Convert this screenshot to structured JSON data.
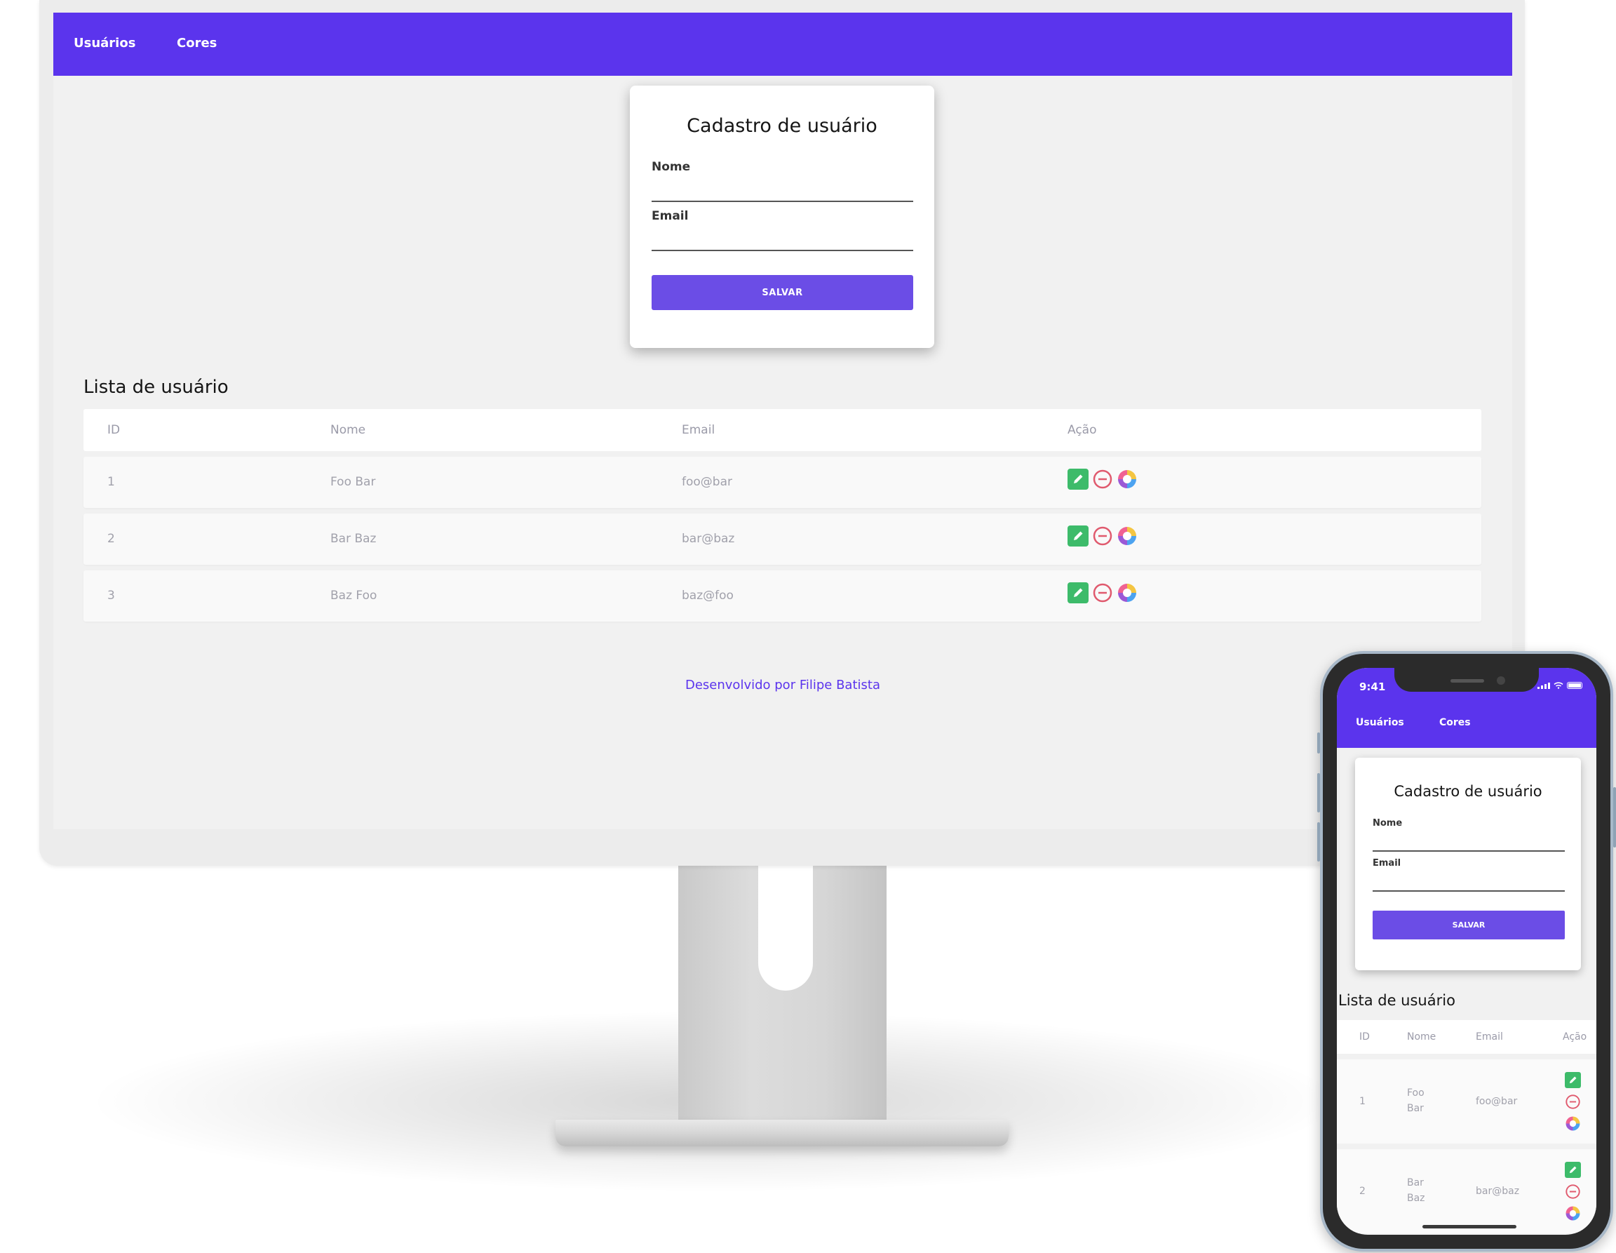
{
  "nav": {
    "users": "Usuários",
    "colors": "Cores"
  },
  "form": {
    "title": "Cadastro de usuário",
    "name_label": "Nome",
    "name_value": "",
    "email_label": "Email",
    "email_value": "",
    "save_label": "SALVAR"
  },
  "list": {
    "title": "Lista de usuário",
    "headers": {
      "id": "ID",
      "name": "Nome",
      "email": "Email",
      "action": "Ação"
    },
    "rows": [
      {
        "id": "1",
        "name": "Foo Bar",
        "email": "foo@bar"
      },
      {
        "id": "2",
        "name": "Bar Baz",
        "email": "bar@baz"
      },
      {
        "id": "3",
        "name": "Baz Foo",
        "email": "baz@foo"
      }
    ]
  },
  "footer": {
    "credit": "Desenvolvido por Filipe Batista"
  },
  "phone": {
    "time": "9:41",
    "rows": [
      {
        "id": "1",
        "name_line1": "Foo",
        "name_line2": "Bar",
        "email": "foo@bar"
      },
      {
        "id": "2",
        "name_line1": "Bar",
        "name_line2": "Baz",
        "email": "bar@baz"
      }
    ]
  },
  "colors": {
    "accent": "#5b34ed",
    "button": "#6b4de6",
    "edit": "#3dbb6a",
    "delete": "#e05a6e"
  },
  "icons": {
    "edit": "pencil-icon",
    "delete": "remove-circle-icon",
    "color": "color-wheel-icon"
  }
}
